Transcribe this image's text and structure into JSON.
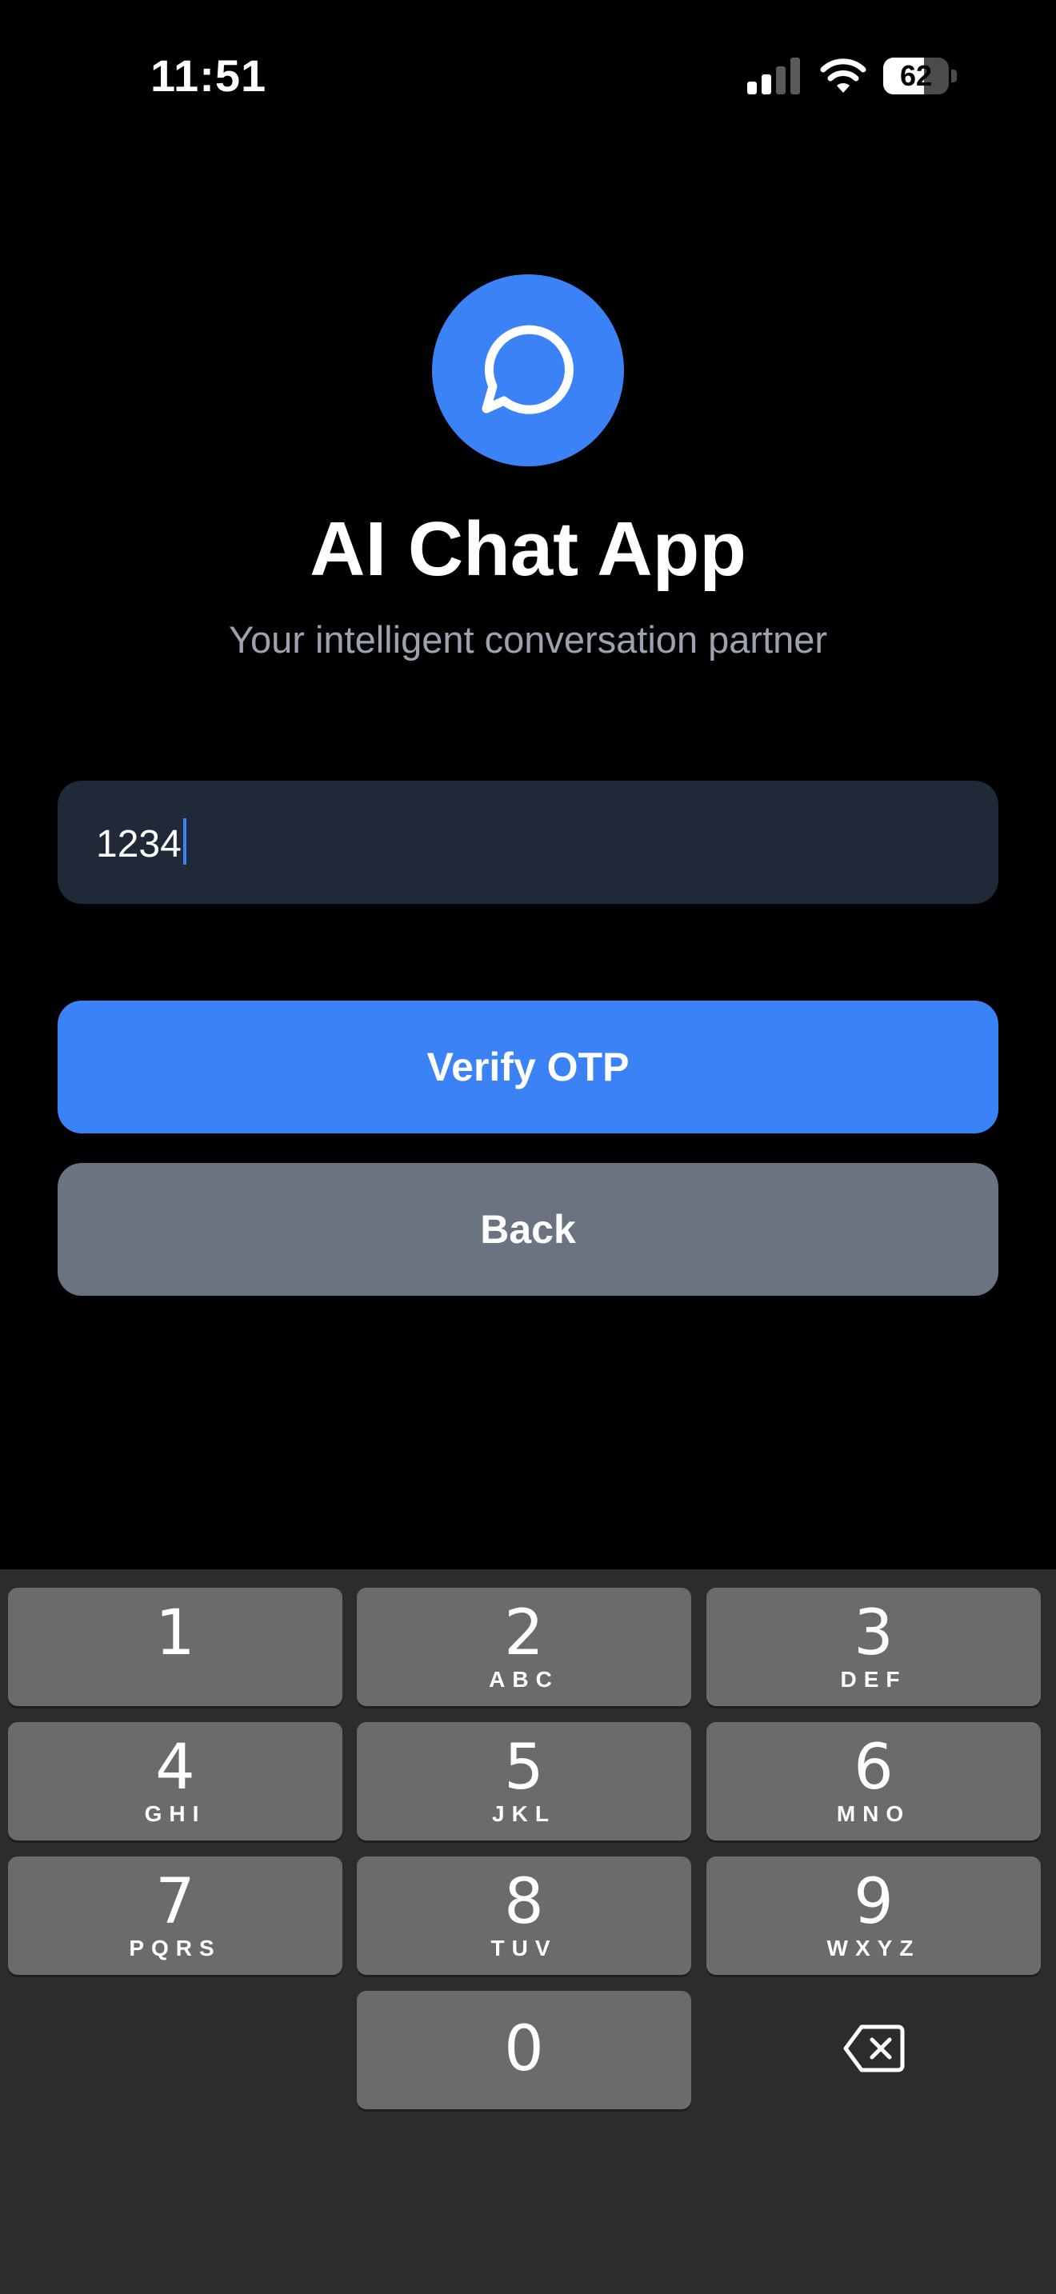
{
  "status_bar": {
    "time": "11:51",
    "battery_level": 62,
    "signal_bars": 2
  },
  "brand": {
    "logo_icon": "chat-bubble-icon",
    "title": "AI Chat App",
    "subtitle": "Your intelligent conversation partner"
  },
  "otp": {
    "value": "1234"
  },
  "actions": {
    "verify_label": "Verify OTP",
    "back_label": "Back"
  },
  "keypad": {
    "keys": [
      {
        "digit": "1",
        "letters": ""
      },
      {
        "digit": "2",
        "letters": "ABC"
      },
      {
        "digit": "3",
        "letters": "DEF"
      },
      {
        "digit": "4",
        "letters": "GHI"
      },
      {
        "digit": "5",
        "letters": "JKL"
      },
      {
        "digit": "6",
        "letters": "MNO"
      },
      {
        "digit": "7",
        "letters": "PQRS"
      },
      {
        "digit": "8",
        "letters": "TUV"
      },
      {
        "digit": "9",
        "letters": "WXYZ"
      },
      {
        "digit": "0",
        "letters": ""
      }
    ],
    "delete_icon": "backspace-icon"
  },
  "colors": {
    "background": "#000000",
    "accent": "#3b82f6",
    "input_background": "#1f2937",
    "secondary_button": "#6b7280",
    "subtitle_text": "#9ca3af",
    "keypad_background": "#2c2c2c",
    "key_background": "#6b6b6b"
  }
}
